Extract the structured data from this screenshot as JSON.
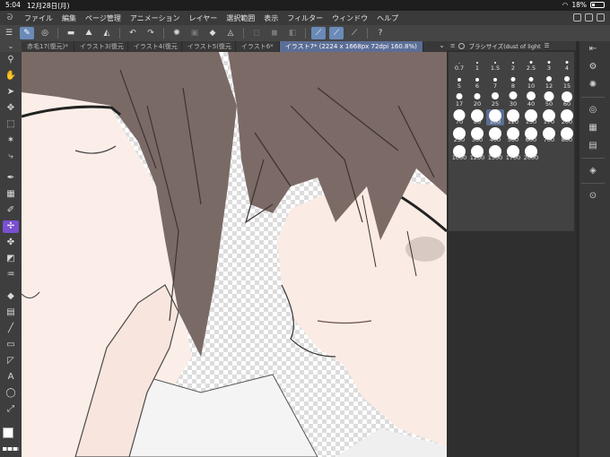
{
  "status": {
    "time": "5:04",
    "date": "12月28日(月)",
    "battery": "18%"
  },
  "menu": [
    "ファイル",
    "編集",
    "ページ管理",
    "アニメーション",
    "レイヤー",
    "選択範囲",
    "表示",
    "フィルター",
    "ウィンドウ",
    "ヘルプ"
  ],
  "tabs": [
    {
      "label": "赤毛17(復元)*"
    },
    {
      "label": "イラスト3(復元"
    },
    {
      "label": "イラスト4(復元"
    },
    {
      "label": "イラスト5(復元"
    },
    {
      "label": "イラスト6*"
    },
    {
      "label": "イラスト7* (2224 x 1668px 72dpi 160.8%)"
    }
  ],
  "brush_panel": {
    "title": "ブラシサイズ(dust of light",
    "selected": "100",
    "sizes": [
      "0.7",
      "1",
      "1.5",
      "2",
      "2.5",
      "3",
      "4",
      "5",
      "6",
      "7",
      "8",
      "10",
      "12",
      "15",
      "17",
      "20",
      "25",
      "30",
      "40",
      "50",
      "60",
      "70",
      "80",
      "100",
      "120",
      "150",
      "170",
      "200",
      "250",
      "300",
      "400",
      "500",
      "600",
      "700",
      "800",
      "1000",
      "1200",
      "1500",
      "1700",
      "2000"
    ]
  },
  "colors": {
    "tool_active": "#7a4fd0",
    "command_active": "#6a8ab8",
    "tab_active": "#5b6e96",
    "main_color": "#ffffff",
    "sub_color": "#6b6b6b"
  }
}
